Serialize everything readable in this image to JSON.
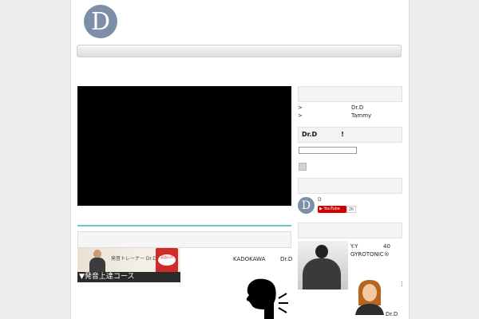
{
  "header": {
    "logo_letter": "D"
  },
  "main": {
    "banner": {
      "small_text": "発音トレーナー Dr.D",
      "book_title": "英語の声",
      "strip_text": "▼発音上達コース"
    },
    "kadokawa": "KADOKAWA",
    "drd": "Dr.D"
  },
  "sidebar": {
    "links": [
      {
        "marker": ">",
        "text": "Dr.D"
      },
      {
        "marker": ">",
        "text": "Tammy"
      }
    ],
    "newsletter": {
      "title": "Dr.D",
      "exclaim": "!"
    },
    "youtube": {
      "avatar_letter": "D",
      "channel_name": "D",
      "button_label": "YouTube",
      "count": "2K"
    },
    "testimonial": {
      "name": "Y.Y",
      "age": "40",
      "studio": "GYROTONIC®",
      "more": "⋮",
      "signature": "Dr.D"
    }
  }
}
